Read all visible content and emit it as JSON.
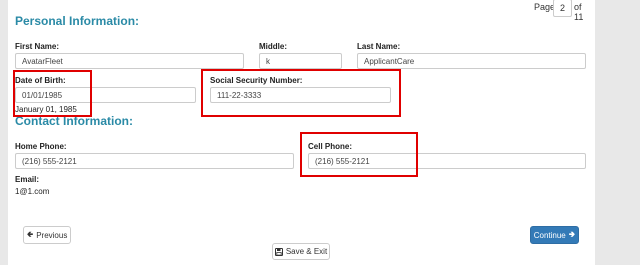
{
  "pagination": {
    "prefix": "Page",
    "current": "2",
    "suffix": "of 11"
  },
  "personal": {
    "title": "Personal Information:",
    "first_name": {
      "label": "First Name:",
      "value": "AvatarFleet"
    },
    "middle": {
      "label": "Middle:",
      "value": "k"
    },
    "last_name": {
      "label": "Last Name:",
      "value": "ApplicantCare"
    },
    "dob": {
      "label": "Date of Birth:",
      "value": "01/01/1985",
      "formatted": "January 01, 1985"
    },
    "ssn": {
      "label": "Social Security Number:",
      "value": "111-22-3333"
    }
  },
  "contact": {
    "title": "Contact Information:",
    "home_phone": {
      "label": "Home Phone:",
      "value": "(216) 555-2121"
    },
    "cell_phone": {
      "label": "Cell Phone:",
      "value": "(216) 555-2121"
    },
    "email": {
      "label": "Email:",
      "value": "1@1.com"
    }
  },
  "nav": {
    "previous_label": "Previous",
    "continue_label": "Continue",
    "save_exit_label": "Save & Exit",
    "previous_icon": "arrow-left-icon",
    "continue_icon": "arrow-right-icon",
    "save_icon": "floppy-disk-icon"
  },
  "colors": {
    "accent": "#2a8aa6",
    "primary_button": "#337ab7",
    "highlight": "#e00000"
  }
}
